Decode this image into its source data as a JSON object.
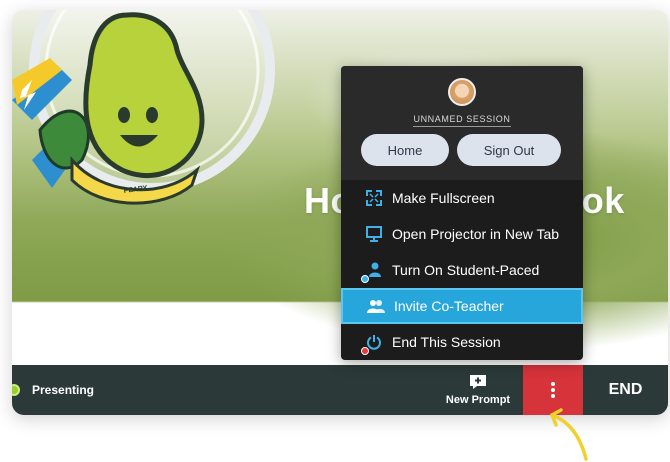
{
  "slide": {
    "title": "How To Handbook",
    "mascot_label": "PEARY"
  },
  "menu": {
    "session_name": "UNNAMED SESSION",
    "home_label": "Home",
    "signout_label": "Sign Out",
    "items": [
      {
        "label": "Make Fullscreen",
        "icon": "fullscreen-icon"
      },
      {
        "label": "Open Projector in New Tab",
        "icon": "projector-icon"
      },
      {
        "label": "Turn On Student-Paced",
        "icon": "student-paced-icon"
      },
      {
        "label": "Invite Co-Teacher",
        "icon": "co-teacher-icon",
        "highlighted": true
      },
      {
        "label": "End This Session",
        "icon": "power-icon"
      }
    ]
  },
  "toolbar": {
    "status_label": "Presenting",
    "new_prompt_label": "New Prompt",
    "end_label": "END"
  },
  "colors": {
    "toolbar_bg": "#2b3a38",
    "more_button_bg": "#d6333a",
    "menu_highlight": "#27a6dc",
    "status_dot": "#9acd32",
    "arrow": "#f0d12a"
  }
}
